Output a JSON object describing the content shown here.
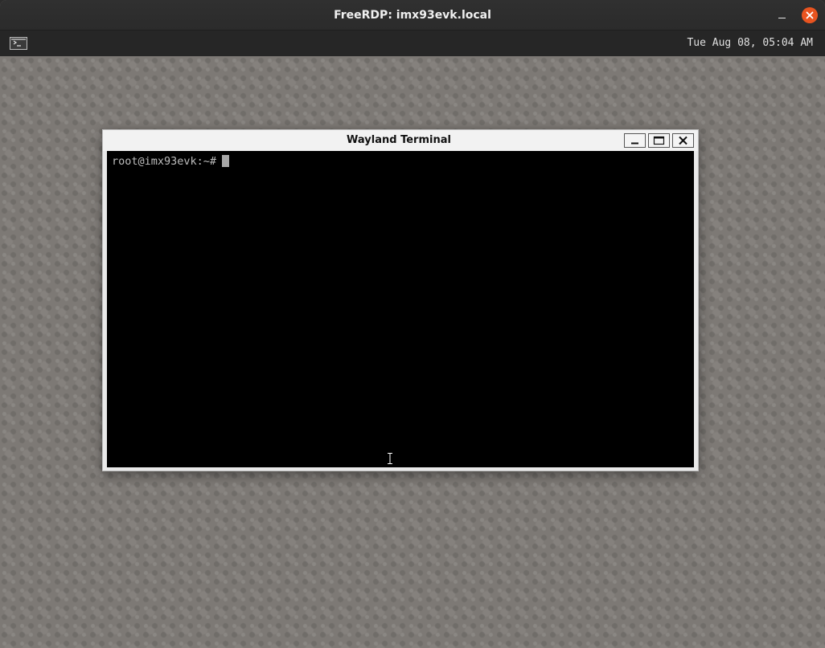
{
  "host_window": {
    "title": "FreeRDP: imx93evk.local",
    "minimize_label": "–",
    "close_icon": "close-icon",
    "accent_color": "#e95420"
  },
  "panel": {
    "launcher_icon": "terminal-launcher-icon",
    "clock": "Tue Aug 08, 05:04 AM"
  },
  "terminal_window": {
    "title": "Wayland Terminal",
    "buttons": [
      "minimize",
      "maximize",
      "close"
    ],
    "prompt": "root@imx93evk:~#",
    "background": "#000000",
    "text_color": "#bdbdbd"
  },
  "pointer": {
    "icon": "text-cursor-ibeam-icon"
  }
}
